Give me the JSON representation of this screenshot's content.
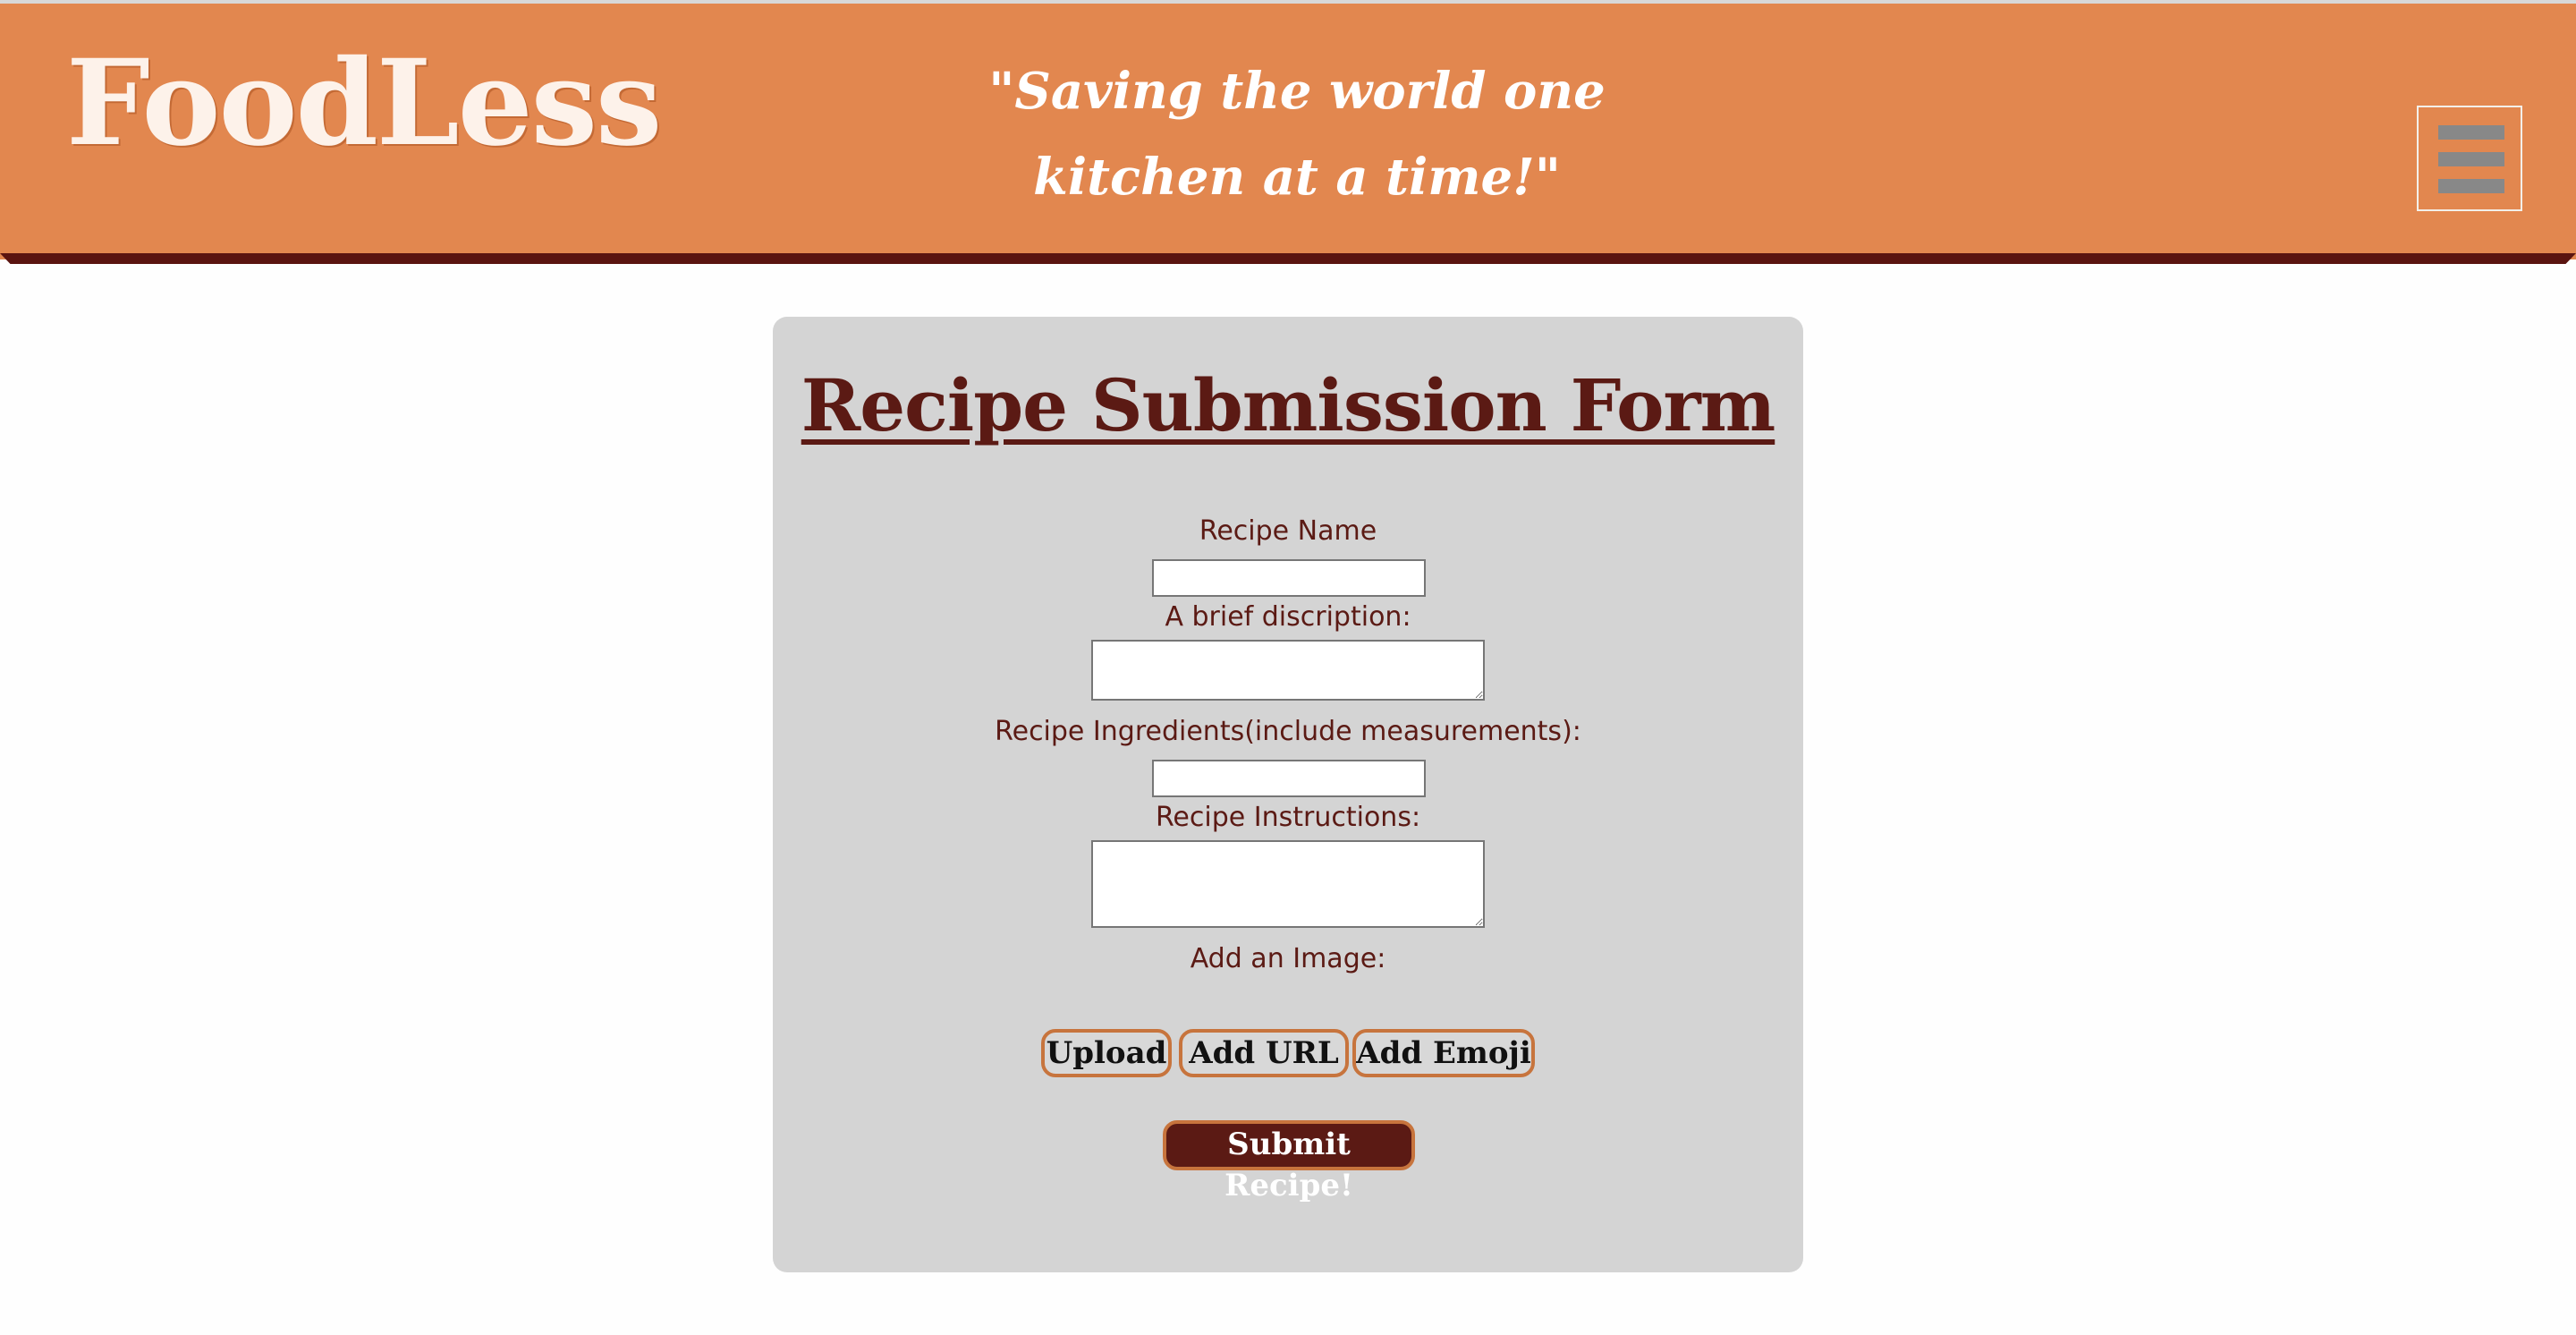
{
  "header": {
    "logo": "FoodLess",
    "tagline": "\"Saving the world one kitchen at a time!\"",
    "menu_icon": "hamburger-menu-icon",
    "background_color": "#e2874f",
    "accent_color": "#5a1410"
  },
  "form": {
    "title": "Recipe Submission Form",
    "recipe_name_label": "Recipe Name",
    "recipe_name_value": "",
    "description_label": "A brief discription:",
    "description_value": "",
    "ingredients_label": "Recipe Ingredients(include measurements):",
    "ingredients_value": "",
    "instructions_label": "Recipe Instructions:",
    "instructions_value": "",
    "image_label": "Add an Image:",
    "buttons": {
      "upload": "Upload",
      "add_url": "Add URL",
      "add_emoji": "Add Emoji"
    },
    "submit_label": "Submit Recipe!",
    "card_color": "#d4d4d4",
    "text_color": "#5b1a14"
  }
}
